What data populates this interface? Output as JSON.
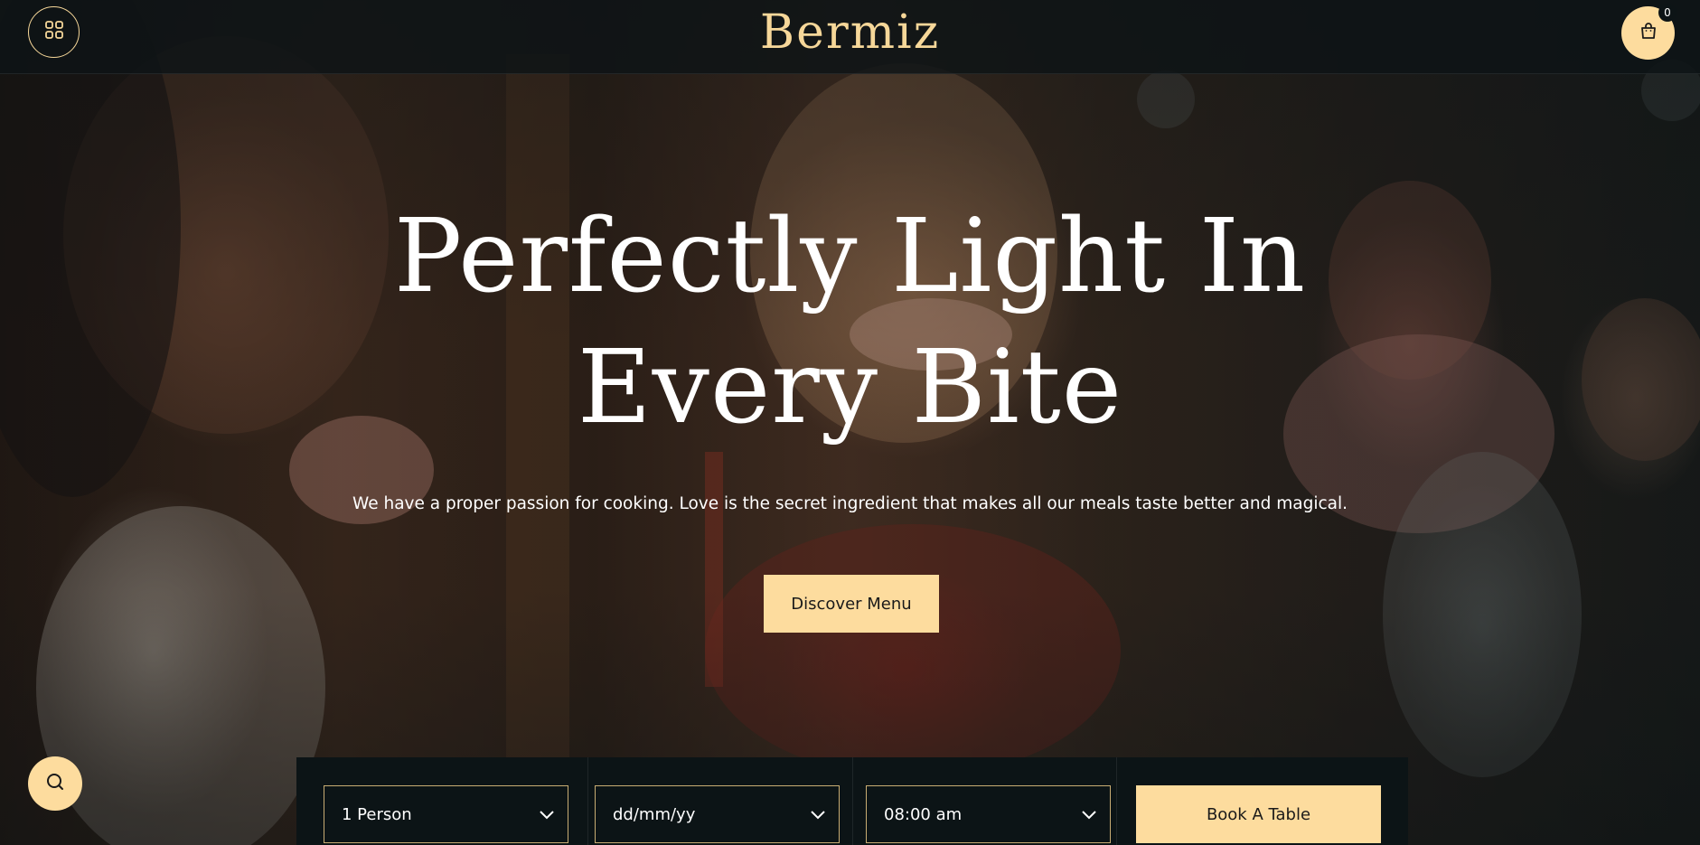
{
  "header": {
    "logo": "Bermiz",
    "menu_icon": "grid-icon",
    "cart_icon": "shopping-bag-icon",
    "cart_count": "0"
  },
  "hero": {
    "title_line1": "Perfectly Light In",
    "title_line2": "Every Bite",
    "subtitle": "We have a proper passion for cooking. Love is the secret ingredient that makes all our meals taste better and magical.",
    "cta_label": "Discover Menu"
  },
  "booking": {
    "persons_value": "1 Person",
    "date_placeholder": "dd/mm/yy",
    "time_value": "08:00 am",
    "submit_label": "Book A Table"
  },
  "floating": {
    "search_icon": "search-icon"
  },
  "colors": {
    "accent": "#fddc9e",
    "dark": "#0d1416",
    "logo": "#f6d799"
  }
}
